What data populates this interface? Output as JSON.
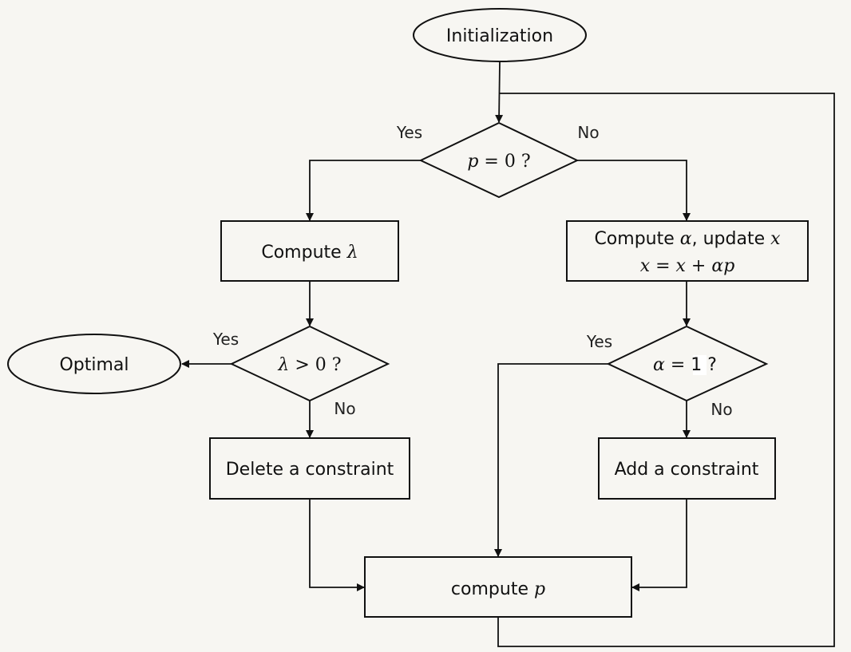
{
  "nodes": {
    "init": "Initialization",
    "cond_p": {
      "var": "p",
      "op": " = 0 ?"
    },
    "compute_lambda": {
      "text": "Compute ",
      "var": "λ"
    },
    "compute_alpha": {
      "text1": "Compute ",
      "var1": "α",
      "text2": ", update ",
      "var2": "x",
      "eq": "x = x + αp"
    },
    "cond_lambda": {
      "var": "λ",
      "op": " > 0 ?"
    },
    "optimal": "Optimal",
    "delete": "Delete a constraint",
    "cond_alpha": {
      "var": "α",
      "op": " = ",
      "one": "1",
      "q": " ?"
    },
    "add": "Add a constraint",
    "compute_p": {
      "text": "compute ",
      "var": "p"
    }
  },
  "edge_labels": {
    "p_yes": "Yes",
    "p_no": "No",
    "lambda_yes": "Yes",
    "lambda_no": "No",
    "alpha_yes": "Yes",
    "alpha_no": "No"
  },
  "colors": {
    "background": "#f7f6f2",
    "stroke": "#111111"
  }
}
